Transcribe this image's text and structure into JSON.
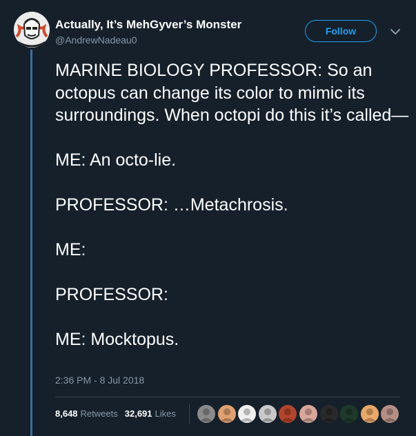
{
  "author": {
    "name": "Actually, It’s MehGyver’s Monster",
    "handle": "@AndrewNadeau0",
    "avatar_icon": "sketch-portrait-avatar"
  },
  "actions": {
    "follow_label": "Follow",
    "menu_icon": "chevron-down-icon"
  },
  "tweet": {
    "paragraphs": [
      "MARINE BIOLOGY PROFESSOR: So an octopus can change its color to mimic its surroundings. When octopi do this it’s called—",
      "ME: An octo-lie.",
      "PROFESSOR: …Metachrosis.",
      "ME:",
      "PROFESSOR:",
      "ME: Mocktopus."
    ],
    "timestamp": "2:36 PM - 8 Jul 2018"
  },
  "stats": {
    "retweets_count": "8,648",
    "retweets_label": "Retweets",
    "likes_count": "32,691",
    "likes_label": "Likes"
  },
  "liker_avatars": [
    {
      "icon": "liker-avatar",
      "color": "#8a8a8a"
    },
    {
      "icon": "liker-avatar",
      "color": "#e0a070"
    },
    {
      "icon": "liker-avatar",
      "color": "#f0f0f0"
    },
    {
      "icon": "liker-avatar",
      "color": "#c9c9c9"
    },
    {
      "icon": "liker-avatar",
      "color": "#b3442b"
    },
    {
      "icon": "liker-avatar",
      "color": "#d8a79a"
    },
    {
      "icon": "liker-avatar",
      "color": "#2a2a2a"
    },
    {
      "icon": "liker-avatar",
      "color": "#1f3a2a"
    },
    {
      "icon": "liker-avatar",
      "color": "#e8a968"
    },
    {
      "icon": "liker-avatar",
      "color": "#b58f84"
    }
  ],
  "colors": {
    "background": "#15202b",
    "accent": "#1da1f2",
    "secondary_text": "#8899a6",
    "thread_line": "#3a6ea5"
  }
}
